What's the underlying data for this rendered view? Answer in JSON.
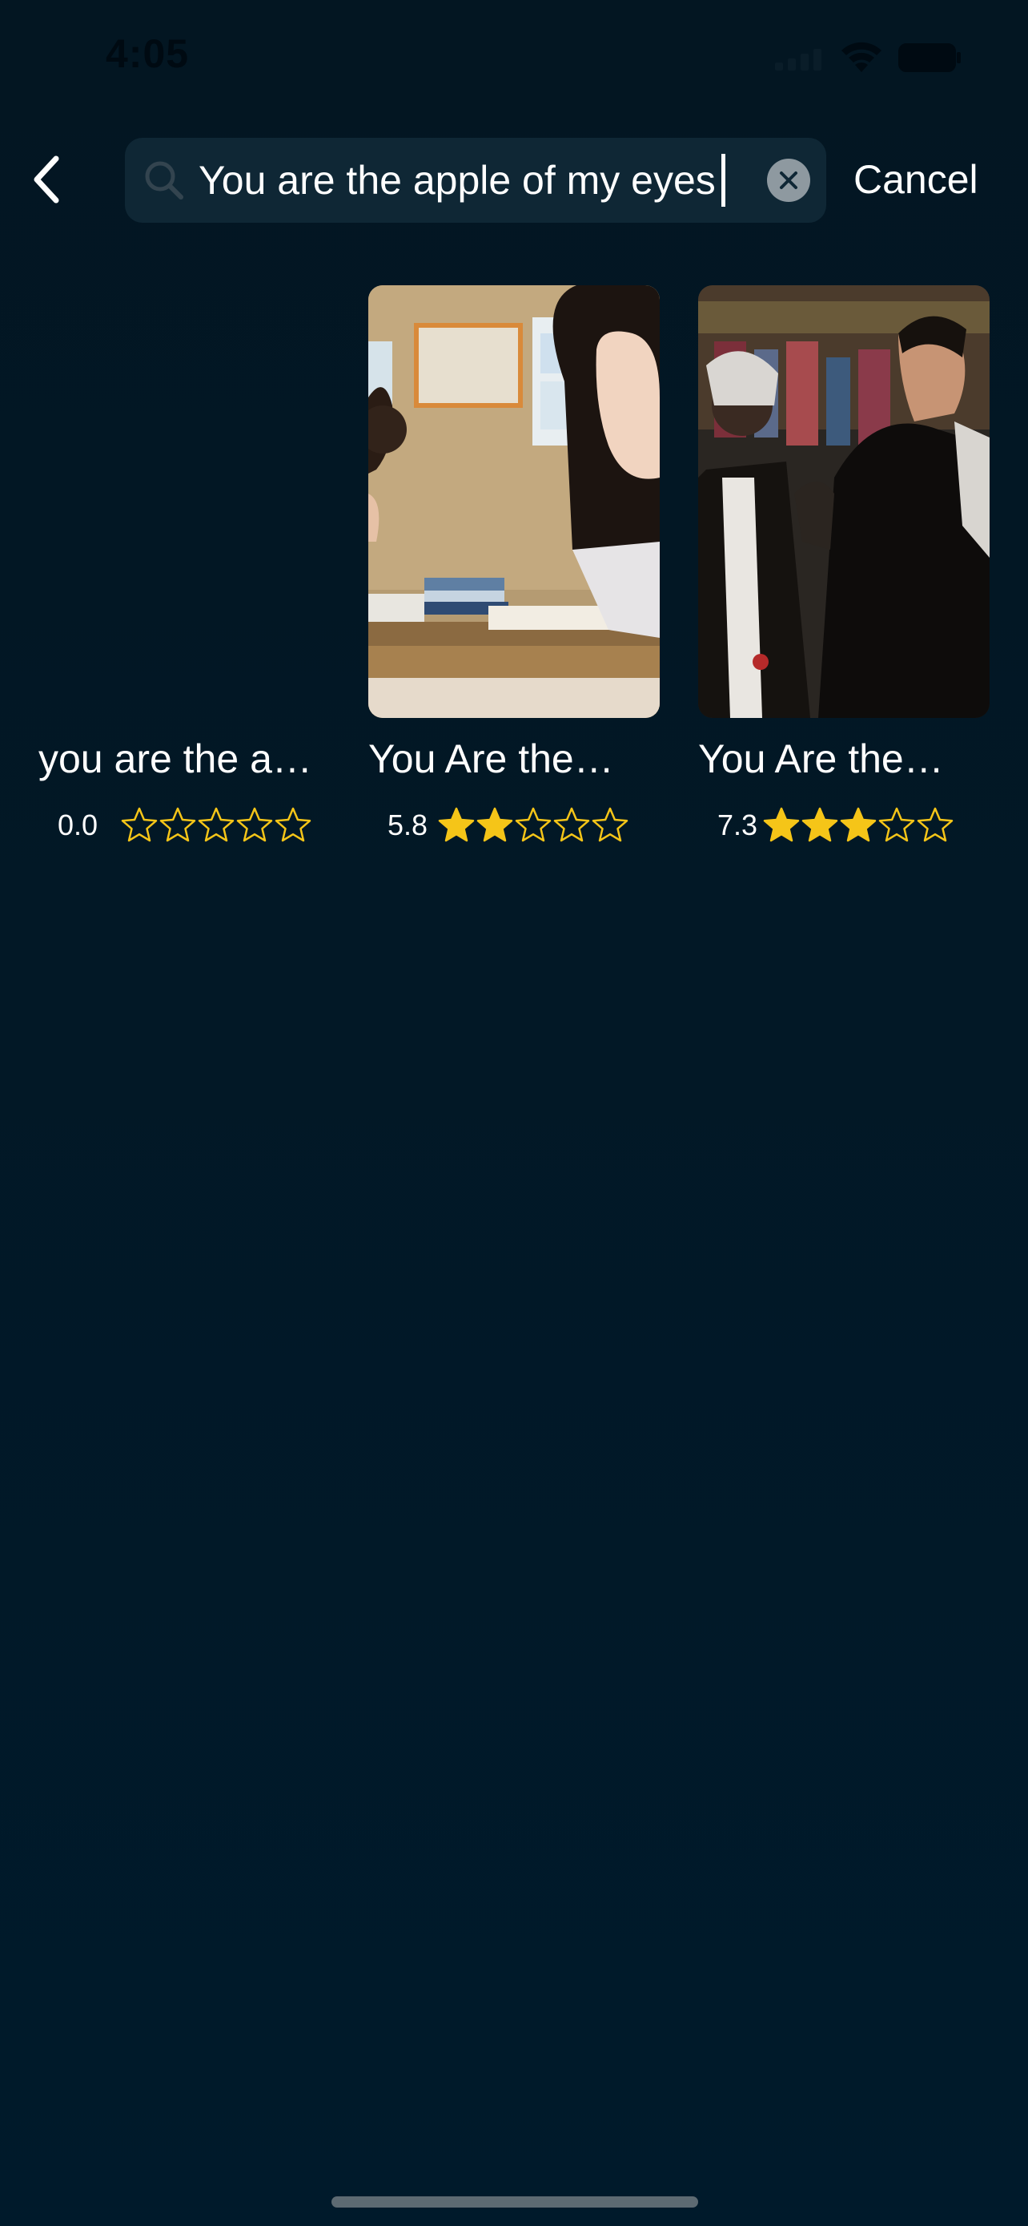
{
  "status_bar": {
    "time": "4:05"
  },
  "search": {
    "query": "You are the apple of my eyes",
    "cancel_label": "Cancel"
  },
  "colors": {
    "accent_star": "#f5c518",
    "background": "#001a2b"
  },
  "results": [
    {
      "title": "you are the a…",
      "rating": "0.0",
      "rating_value": 0.0,
      "filled_stars": 0
    },
    {
      "title": "You Are the…",
      "rating": "5.8",
      "rating_value": 5.8,
      "filled_stars": 2
    },
    {
      "title": "You Are the…",
      "rating": "7.3",
      "rating_value": 7.3,
      "filled_stars": 3
    }
  ]
}
